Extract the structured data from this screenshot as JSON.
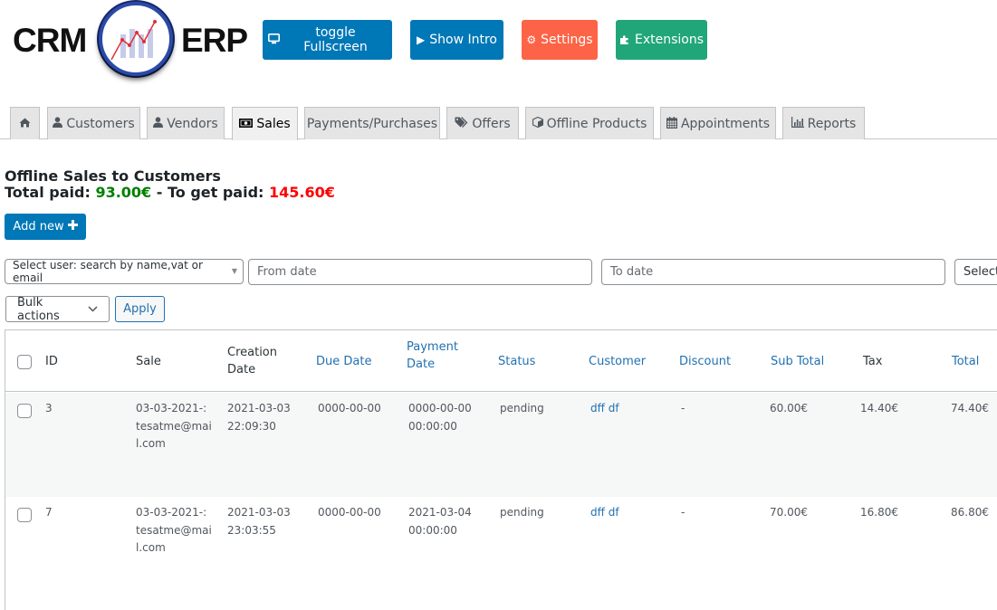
{
  "app": {
    "logo": {
      "left_text": "CRM",
      "right_text": "ERP",
      "icon": "chart-logo-icon"
    }
  },
  "header_buttons": [
    {
      "label": "toggle Fullscreen",
      "icon": "monitor-icon",
      "color": "#0077b6"
    },
    {
      "label": "Show Intro",
      "icon": "play-icon",
      "color": "#0077b6"
    },
    {
      "label": "Settings",
      "icon": "gear-icon",
      "color": "#fd6346"
    },
    {
      "label": "Extensions",
      "icon": "puzzle-icon",
      "color": "#21a67a"
    }
  ],
  "tabs": [
    {
      "label": "",
      "icon": "home-icon",
      "active": false
    },
    {
      "label": "Customers",
      "icon": "user-icon",
      "active": false
    },
    {
      "label": "Vendors",
      "icon": "user-icon",
      "active": false
    },
    {
      "label": "Sales",
      "icon": "money-icon",
      "active": true
    },
    {
      "label": "Payments/Purchases",
      "icon": "",
      "active": false
    },
    {
      "label": "Offers",
      "icon": "tags-icon",
      "active": false
    },
    {
      "label": "Offline Products",
      "icon": "cube-icon",
      "active": false
    },
    {
      "label": "Appointments",
      "icon": "calendar-icon",
      "active": false
    },
    {
      "label": "Reports",
      "icon": "bar-chart-icon",
      "active": false
    }
  ],
  "page": {
    "title": "Offline Sales to Customers",
    "total_paid_label": "Total paid: ",
    "total_paid_value": "93.00€",
    "separator": " - To get paid: ",
    "to_get_paid_value": "145.60€",
    "paid_color": "#008000",
    "unpaid_color": "#ff0000",
    "add_new_label": "Add new"
  },
  "filters": {
    "user_select": "Select user: search by name,vat or email",
    "from_date_placeholder": "From date",
    "to_date_placeholder": "To date",
    "status_select": "Select",
    "bulk_actions": "Bulk actions",
    "apply_label": "Apply"
  },
  "table": {
    "columns": {
      "id": "ID",
      "sale": "Sale",
      "creation_date": [
        "Creation",
        "Date"
      ],
      "due_date": "Due Date",
      "payment_date": [
        "Payment",
        "Date"
      ],
      "status": "Status",
      "customer": "Customer",
      "discount": "Discount",
      "sub_total": "Sub Total",
      "tax": "Tax",
      "total": "Total"
    },
    "rows": [
      {
        "id": "3",
        "sale": [
          "03-03-2021-:",
          "tesatme@mai",
          "l.com"
        ],
        "creation_date": [
          "2021-03-03",
          "22:09:30"
        ],
        "due_date": "0000-00-00",
        "payment_date": [
          "0000-00-00",
          "00:00:00"
        ],
        "status": "pending",
        "customer": "dff df",
        "discount": "-",
        "sub_total": "60.00€",
        "tax": "14.40€",
        "total": "74.40€"
      },
      {
        "id": "7",
        "sale": [
          "03-03-2021-:",
          "tesatme@mai",
          "l.com"
        ],
        "creation_date": [
          "2021-03-03",
          "23:03:55"
        ],
        "due_date": "0000-00-00",
        "payment_date": [
          "2021-03-04",
          "00:00:00"
        ],
        "status": "pending",
        "customer": "dff df",
        "discount": "-",
        "sub_total": "70.00€",
        "tax": "16.80€",
        "total": "86.80€"
      }
    ]
  }
}
